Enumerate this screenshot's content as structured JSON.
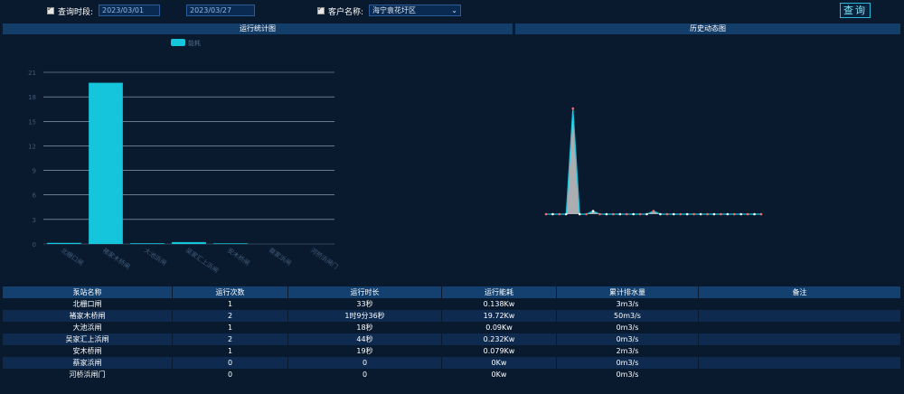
{
  "filters": {
    "period_label": "查询时段:",
    "date_from": "2023/03/01",
    "date_to": "2023/03/27",
    "customer_label": "客户名称:",
    "customer_value": "海宁袁花圩区",
    "query_button": "查询"
  },
  "panels": {
    "left_title": "运行统计图",
    "right_title": "历史动态图"
  },
  "chart_data": [
    {
      "type": "bar",
      "title": "运行统计图",
      "legend": [
        "能耗"
      ],
      "legend_position": "top",
      "categories": [
        "北栅口闸",
        "褚家木桥闸",
        "大池浜闸",
        "吴家汇上浜闸",
        "安木桥闸",
        "蔡家浜闸",
        "河桥浜闸门"
      ],
      "series": [
        {
          "name": "能耗",
          "values": [
            0.138,
            19.72,
            0.09,
            0.232,
            0.079,
            0,
            0
          ]
        }
      ],
      "yticks": [
        0,
        3,
        6,
        9,
        12,
        15,
        18,
        21
      ],
      "ylim": [
        0,
        21
      ],
      "grid": true,
      "color": "#14c5dc"
    },
    {
      "type": "area",
      "title": "历史动态图",
      "values": [
        0,
        0,
        0,
        0,
        0,
        0,
        0,
        0.5,
        0,
        0,
        0,
        0,
        0,
        0,
        0,
        0,
        0,
        0,
        0,
        0,
        0,
        0,
        0,
        0,
        0,
        0,
        0,
        0,
        0,
        0,
        0,
        0,
        0
      ],
      "peak_values": {
        "4": 17,
        "16": 0.5
      },
      "fill_color": "#c8c8c8",
      "line_color": "#14c5dc",
      "marker_color": "#ff6a6a"
    }
  ],
  "table": {
    "headers": [
      "泵站名称",
      "运行次数",
      "运行时长",
      "运行能耗",
      "累计排水量",
      "备注"
    ],
    "rows": [
      [
        "北栅口闸",
        "1",
        "33秒",
        "0.138Kw",
        "3m3/s",
        ""
      ],
      [
        "褚家木桥闸",
        "2",
        "1时9分36秒",
        "19.72Kw",
        "50m3/s",
        ""
      ],
      [
        "大池浜闸",
        "1",
        "18秒",
        "0.09Kw",
        "0m3/s",
        ""
      ],
      [
        "吴家汇上浜闸",
        "2",
        "44秒",
        "0.232Kw",
        "0m3/s",
        ""
      ],
      [
        "安木桥闸",
        "1",
        "19秒",
        "0.079Kw",
        "2m3/s",
        ""
      ],
      [
        "蔡家浜闸",
        "0",
        "0",
        "0Kw",
        "0m3/s",
        ""
      ],
      [
        "河桥浜闸门",
        "0",
        "0",
        "0Kw",
        "0m3/s",
        ""
      ]
    ]
  }
}
